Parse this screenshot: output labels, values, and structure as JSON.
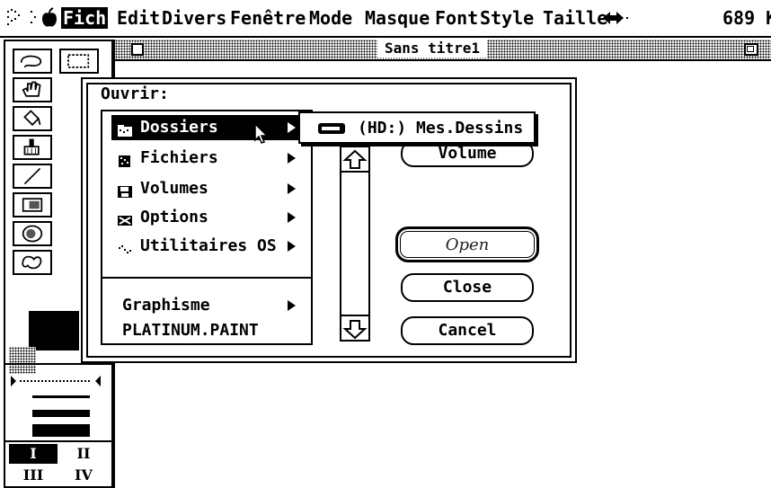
{
  "menubar": {
    "items": [
      "Fich",
      "Edit",
      "Divers",
      "Fenêtre",
      "Mode",
      "Masque",
      "Font",
      "Style",
      "Taille"
    ],
    "memory": "689 K"
  },
  "document": {
    "title": "Sans titre1"
  },
  "dialog": {
    "heading": "Ouvrir:",
    "list": [
      {
        "label": "Dossiers",
        "icon": "folder-icon",
        "submenu": true,
        "selected": true
      },
      {
        "label": "Fichiers",
        "icon": "file-icon",
        "submenu": true,
        "selected": false
      },
      {
        "label": "Volumes",
        "icon": "disk-icon",
        "submenu": true,
        "selected": false
      },
      {
        "label": "Options",
        "icon": "options-icon",
        "submenu": true,
        "selected": false
      },
      {
        "label": "Utilitaires OS",
        "icon": "utilities-icon",
        "submenu": true,
        "selected": false
      }
    ],
    "graphisme": "Graphisme",
    "app_name": "PLATINUM.PAINT",
    "buttons": {
      "volume": "Volume",
      "open": "Open",
      "close": "Close",
      "cancel": "Cancel"
    },
    "submenu_item": "(HD:) Mes.Dessins"
  },
  "palette": {
    "numerals": [
      "I",
      "II",
      "III",
      "IV"
    ]
  }
}
